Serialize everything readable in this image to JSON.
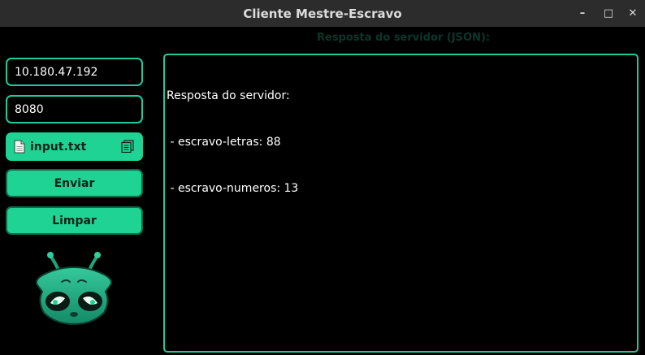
{
  "window": {
    "title": "Cliente Mestre-Escravo",
    "controls": {
      "minimize": "–",
      "maximize": "□",
      "close": "✕"
    }
  },
  "form": {
    "ip_value": "10.180.47.192",
    "port_value": "8080",
    "file_label": "input.txt",
    "send_label": "Enviar",
    "clear_label": "Limpar"
  },
  "response": {
    "heading": "Resposta do servidor (JSON):",
    "lines": [
      "Resposta do servidor:",
      " - escravo-letras: 88",
      " - escravo-numeros: 13"
    ]
  },
  "colors": {
    "accent": "#1ed394",
    "border": "#22c99c",
    "background": "#000000",
    "titlebar": "#2c2c2c"
  },
  "icons": {
    "file": "document-icon",
    "browse": "file-browse-icon",
    "mascot": "alien-mascot"
  }
}
